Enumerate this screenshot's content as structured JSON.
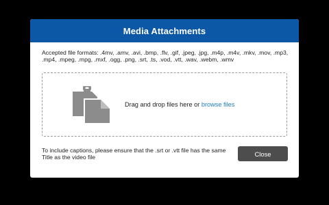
{
  "dialog": {
    "title": "Media Attachments",
    "accepted_formats": "Accepted file formats: .4mv, .amv, .avi, .bmp, .flv, .gif, .jpeg, .jpg, .m4p, .m4v, .mkv, .mov, .mp3, .mp4, .mpeg, .mpg, .mxf, .ogg, .png, .srt, .ts, .vod, .vtt, .wav, .webm, .wmv",
    "dropzone": {
      "icon": "files-icon",
      "text": "Drag and drop files here or ",
      "browse_label": "browse files"
    },
    "captions_note": "To include captions, please ensure that the .srt or .vtt file has the same Title as the video file",
    "close_label": "Close"
  },
  "colors": {
    "header": "#0d57a7",
    "link": "#1f7fc4",
    "close_button": "#4d4d4d",
    "icon": "#8c8c8c"
  }
}
